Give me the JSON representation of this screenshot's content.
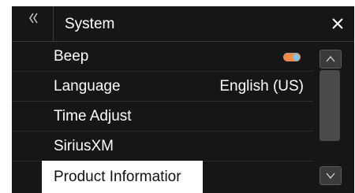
{
  "header": {
    "title": "System",
    "back_icon": "double-chevron-left-icon",
    "close_icon": "close-icon"
  },
  "items": [
    {
      "label": "Beep",
      "control": "toggle",
      "toggle_on": true
    },
    {
      "label": "Language",
      "value": "English (US)"
    },
    {
      "label": "Time Adjust"
    },
    {
      "label": "SiriusXM"
    },
    {
      "label": "Product Informatior",
      "highlighted": true
    }
  ],
  "scrollbar": {
    "up_icon": "chevron-up-icon",
    "down_icon": "chevron-down-icon"
  },
  "colors": {
    "background": "#161616",
    "toggle_track": "#f08a4b",
    "toggle_knob": "#7ec4e8",
    "highlight": "#ffffff"
  }
}
